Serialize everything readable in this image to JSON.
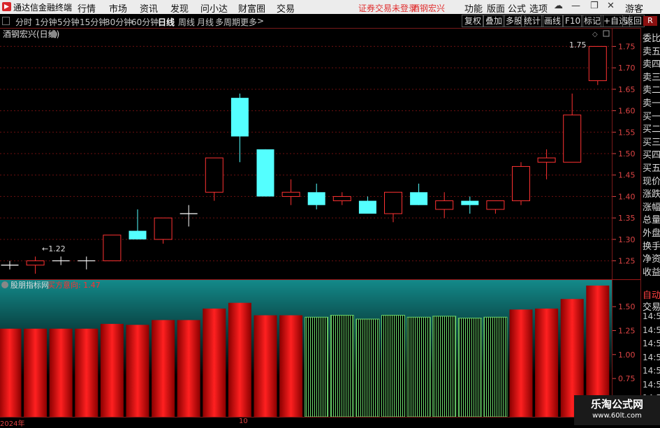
{
  "titlebar": {
    "app_title": "通达信金融终端",
    "menus": [
      "行情",
      "市场",
      "资讯",
      "发现",
      "问小达",
      "财富圈",
      "交易"
    ],
    "warning": "证券交易未登录",
    "stock_link": "酒钢宏兴",
    "right_menus": [
      "功能",
      "版面",
      "公式",
      "选项"
    ],
    "guest": "游客"
  },
  "period_toolbar": {
    "tabs": [
      "分时",
      "1分钟",
      "5分钟",
      "15分钟",
      "30分钟",
      "60分钟",
      "日线",
      "周线",
      "月线",
      "多周期",
      "更多"
    ],
    "active": "日线",
    "right_buttons": [
      "复权",
      "叠加",
      "多股",
      "统计",
      "画线",
      "F10",
      "标记",
      "+自选",
      "返回"
    ]
  },
  "main_chart": {
    "title": "酒钢宏兴(日线)",
    "high_label": "1.75",
    "low_label": "1.22",
    "y_ticks": [
      "1.75",
      "1.70",
      "1.65",
      "1.60",
      "1.55",
      "1.50",
      "1.45",
      "1.40",
      "1.35",
      "1.30",
      "1.25"
    ]
  },
  "sub_chart": {
    "indicator": "股朋指标网",
    "readout": "买方意向: 1.47",
    "y_ticks": [
      "1.50",
      "1.25",
      "1.00",
      "0.75",
      "0.50"
    ]
  },
  "side_panel": {
    "items": [
      "委比",
      "卖五",
      "卖四",
      "卖三",
      "卖二",
      "卖一",
      "买一",
      "买二",
      "买三",
      "买四",
      "买五",
      "现价",
      "涨跌",
      "涨幅",
      "总量",
      "外盘",
      "换手",
      "净资",
      "收益"
    ],
    "lower_items": [
      "自动",
      "交易"
    ],
    "times": [
      "14:56",
      "14:56",
      "14:56",
      "14:56",
      "14:56",
      "14:56",
      "14:56",
      "14:56"
    ]
  },
  "bottom_axis": {
    "year_label": "2024年",
    "month_label": "10"
  },
  "watermark": {
    "line1": "乐淘公式网",
    "line2": "www.60lt.com"
  },
  "chart_data": [
    {
      "type": "candlestick",
      "title": "酒钢宏兴(日线)",
      "ylim": [
        1.22,
        1.78
      ],
      "candles": [
        {
          "o": 1.24,
          "h": 1.25,
          "l": 1.23,
          "c": 1.24
        },
        {
          "o": 1.24,
          "h": 1.26,
          "l": 1.22,
          "c": 1.25
        },
        {
          "o": 1.25,
          "h": 1.26,
          "l": 1.24,
          "c": 1.25
        },
        {
          "o": 1.25,
          "h": 1.26,
          "l": 1.23,
          "c": 1.25
        },
        {
          "o": 1.25,
          "h": 1.31,
          "l": 1.25,
          "c": 1.31
        },
        {
          "o": 1.32,
          "h": 1.37,
          "l": 1.3,
          "c": 1.3
        },
        {
          "o": 1.3,
          "h": 1.35,
          "l": 1.29,
          "c": 1.35
        },
        {
          "o": 1.36,
          "h": 1.38,
          "l": 1.33,
          "c": 1.36
        },
        {
          "o": 1.41,
          "h": 1.49,
          "l": 1.39,
          "c": 1.49
        },
        {
          "o": 1.63,
          "h": 1.64,
          "l": 1.48,
          "c": 1.54
        },
        {
          "o": 1.51,
          "h": 1.51,
          "l": 1.4,
          "c": 1.4
        },
        {
          "o": 1.4,
          "h": 1.44,
          "l": 1.38,
          "c": 1.41
        },
        {
          "o": 1.41,
          "h": 1.43,
          "l": 1.37,
          "c": 1.38
        },
        {
          "o": 1.39,
          "h": 1.41,
          "l": 1.38,
          "c": 1.4
        },
        {
          "o": 1.39,
          "h": 1.4,
          "l": 1.36,
          "c": 1.36
        },
        {
          "o": 1.36,
          "h": 1.41,
          "l": 1.34,
          "c": 1.41
        },
        {
          "o": 1.41,
          "h": 1.43,
          "l": 1.38,
          "c": 1.38
        },
        {
          "o": 1.37,
          "h": 1.41,
          "l": 1.35,
          "c": 1.39
        },
        {
          "o": 1.39,
          "h": 1.4,
          "l": 1.36,
          "c": 1.38
        },
        {
          "o": 1.37,
          "h": 1.39,
          "l": 1.36,
          "c": 1.39
        },
        {
          "o": 1.39,
          "h": 1.48,
          "l": 1.38,
          "c": 1.47
        },
        {
          "o": 1.48,
          "h": 1.51,
          "l": 1.44,
          "c": 1.49
        },
        {
          "o": 1.48,
          "h": 1.64,
          "l": 1.48,
          "c": 1.59
        },
        {
          "o": 1.67,
          "h": 1.75,
          "l": 1.66,
          "c": 1.75
        }
      ]
    },
    {
      "type": "bar",
      "title": "股朋指标网",
      "ylim": [
        0.35,
        1.72
      ],
      "values": [
        1.27,
        1.27,
        1.27,
        1.27,
        1.32,
        1.31,
        1.36,
        1.36,
        1.48,
        1.54,
        1.41,
        1.41,
        1.39,
        1.41,
        1.37,
        1.41,
        1.39,
        1.4,
        1.38,
        1.39,
        1.47,
        1.48,
        1.58,
        1.72
      ],
      "colors": [
        "red",
        "red",
        "red",
        "red",
        "red",
        "red",
        "red",
        "red",
        "red",
        "red",
        "red",
        "red",
        "green",
        "green",
        "green",
        "green",
        "green",
        "green",
        "green",
        "green",
        "red",
        "red",
        "red",
        "red"
      ]
    }
  ],
  "colors": {
    "bull": "#ff3232",
    "bear": "#54ffff",
    "grid": "#6e1010",
    "axis": "#d44",
    "green_bar": "#6bd66b"
  }
}
